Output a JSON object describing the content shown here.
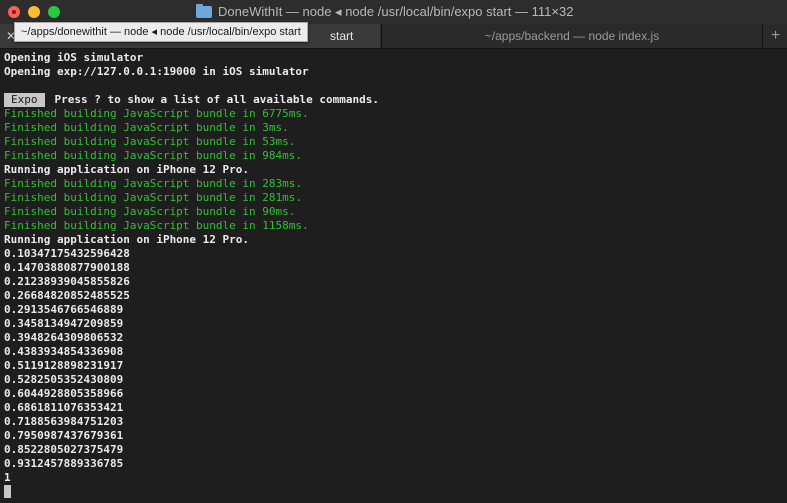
{
  "window": {
    "title": "DoneWithIt — node ◂ node /usr/local/bin/expo start — 111×32"
  },
  "tabs": {
    "active_label": "start",
    "inactive_label": "~/apps/backend — node index.js",
    "add_symbol": "+",
    "close_symbol": "✕"
  },
  "tooltip": {
    "text": "~/apps/donewithit — node ◂ node /usr/local/bin/expo start"
  },
  "terminal": {
    "lines": [
      {
        "text": "Opening iOS simulator",
        "style": "bold"
      },
      {
        "text": "Opening exp://127.0.0.1:19000 in iOS simulator",
        "style": "bold"
      },
      {
        "text": "",
        "style": "plain"
      },
      {
        "badge": "Expo",
        "text": "Press ? to show a list of all available commands.",
        "style": "bold"
      },
      {
        "text": "Finished building JavaScript bundle in 6775ms.",
        "style": "green"
      },
      {
        "text": "Finished building JavaScript bundle in 3ms.",
        "style": "green"
      },
      {
        "text": "Finished building JavaScript bundle in 53ms.",
        "style": "green"
      },
      {
        "text": "Finished building JavaScript bundle in 984ms.",
        "style": "green"
      },
      {
        "text": "Running application on iPhone 12 Pro.",
        "style": "bold"
      },
      {
        "text": "Finished building JavaScript bundle in 283ms.",
        "style": "green"
      },
      {
        "text": "Finished building JavaScript bundle in 281ms.",
        "style": "green"
      },
      {
        "text": "Finished building JavaScript bundle in 90ms.",
        "style": "green"
      },
      {
        "text": "Finished building JavaScript bundle in 1158ms.",
        "style": "green"
      },
      {
        "text": "Running application on iPhone 12 Pro.",
        "style": "bold"
      },
      {
        "text": "0.10347175432596428",
        "style": "bold"
      },
      {
        "text": "0.14703880877900188",
        "style": "bold"
      },
      {
        "text": "0.21238939045855826",
        "style": "bold"
      },
      {
        "text": "0.26684820852485525",
        "style": "bold"
      },
      {
        "text": "0.2913546766546889",
        "style": "bold"
      },
      {
        "text": "0.3458134947209859",
        "style": "bold"
      },
      {
        "text": "0.3948264309806532",
        "style": "bold"
      },
      {
        "text": "0.4383934854336908",
        "style": "bold"
      },
      {
        "text": "0.5119128898231917",
        "style": "bold"
      },
      {
        "text": "0.5282505352430809",
        "style": "bold"
      },
      {
        "text": "0.6044928805358966",
        "style": "bold"
      },
      {
        "text": "0.6861811076353421",
        "style": "bold"
      },
      {
        "text": "0.7188563984751203",
        "style": "bold"
      },
      {
        "text": "0.7950987437679361",
        "style": "bold"
      },
      {
        "text": "0.8522805027375479",
        "style": "bold"
      },
      {
        "text": "0.9312457889336785",
        "style": "bold"
      },
      {
        "text": "1",
        "style": "bold"
      }
    ]
  },
  "colors": {
    "background": "#1e1e1e",
    "text": "#ebebeb",
    "success_green": "#2fc22f",
    "badge_bg": "#c7c7c7"
  }
}
